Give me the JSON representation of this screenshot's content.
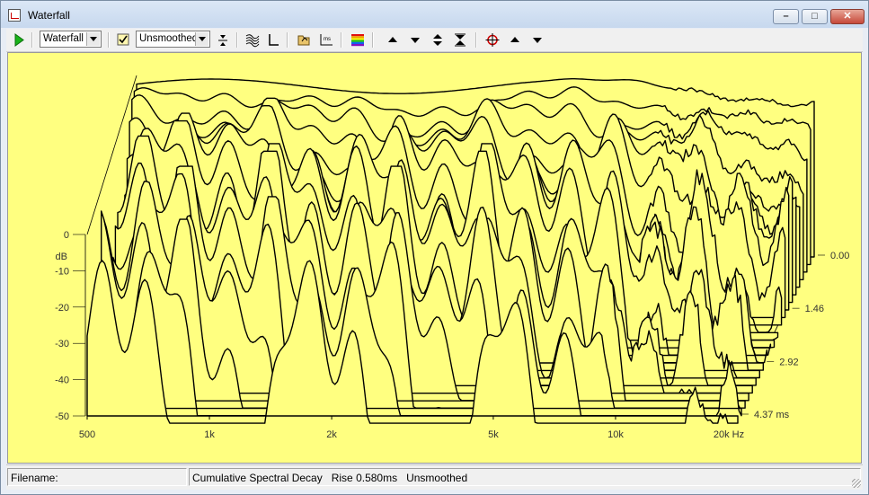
{
  "window": {
    "title": "Waterfall"
  },
  "titlebar_buttons": {
    "minimize": "–",
    "maximize": "□",
    "close": "✕"
  },
  "toolbar": {
    "view_select": "Waterfall",
    "smoothing_select": "Unsmoothed",
    "icons": [
      "play-icon",
      "view-select",
      "checkbox-icon",
      "smoothing-select",
      "fit-icon",
      "waterfall-icon",
      "axes-icon",
      "open-icon",
      "ms-icon",
      "palette-icon",
      "up-icon",
      "down-icon",
      "expand-icon",
      "compress-icon",
      "cursor-icon",
      "cursor-up-icon",
      "cursor-down-icon"
    ]
  },
  "status": {
    "filename_label": "Filename:",
    "info": "Cumulative Spectral Decay   Rise 0.580ms   Unsmoothed"
  },
  "colors": {
    "plot_bg": "#ffff80",
    "trace": "#000000",
    "window_bg": "#e8edf5"
  },
  "chart_data": {
    "type": "waterfall",
    "x_axis": {
      "scale": "log",
      "range": [
        500,
        20000
      ],
      "tick_labels": [
        "500",
        "1k",
        "2k",
        "5k",
        "10k",
        "20k Hz"
      ]
    },
    "y_axis": {
      "unit": "dB",
      "range": [
        -50,
        0
      ],
      "tick_labels": [
        "0",
        "-10",
        "-20",
        "-30",
        "-40",
        "-50"
      ],
      "unit_label": "dB"
    },
    "z_axis": {
      "unit": "ms",
      "range": [
        0,
        4.37
      ],
      "tick_labels": [
        "0.00",
        "1.46",
        "2.92",
        "4.37 ms"
      ]
    },
    "slices": 22,
    "grid": false
  }
}
